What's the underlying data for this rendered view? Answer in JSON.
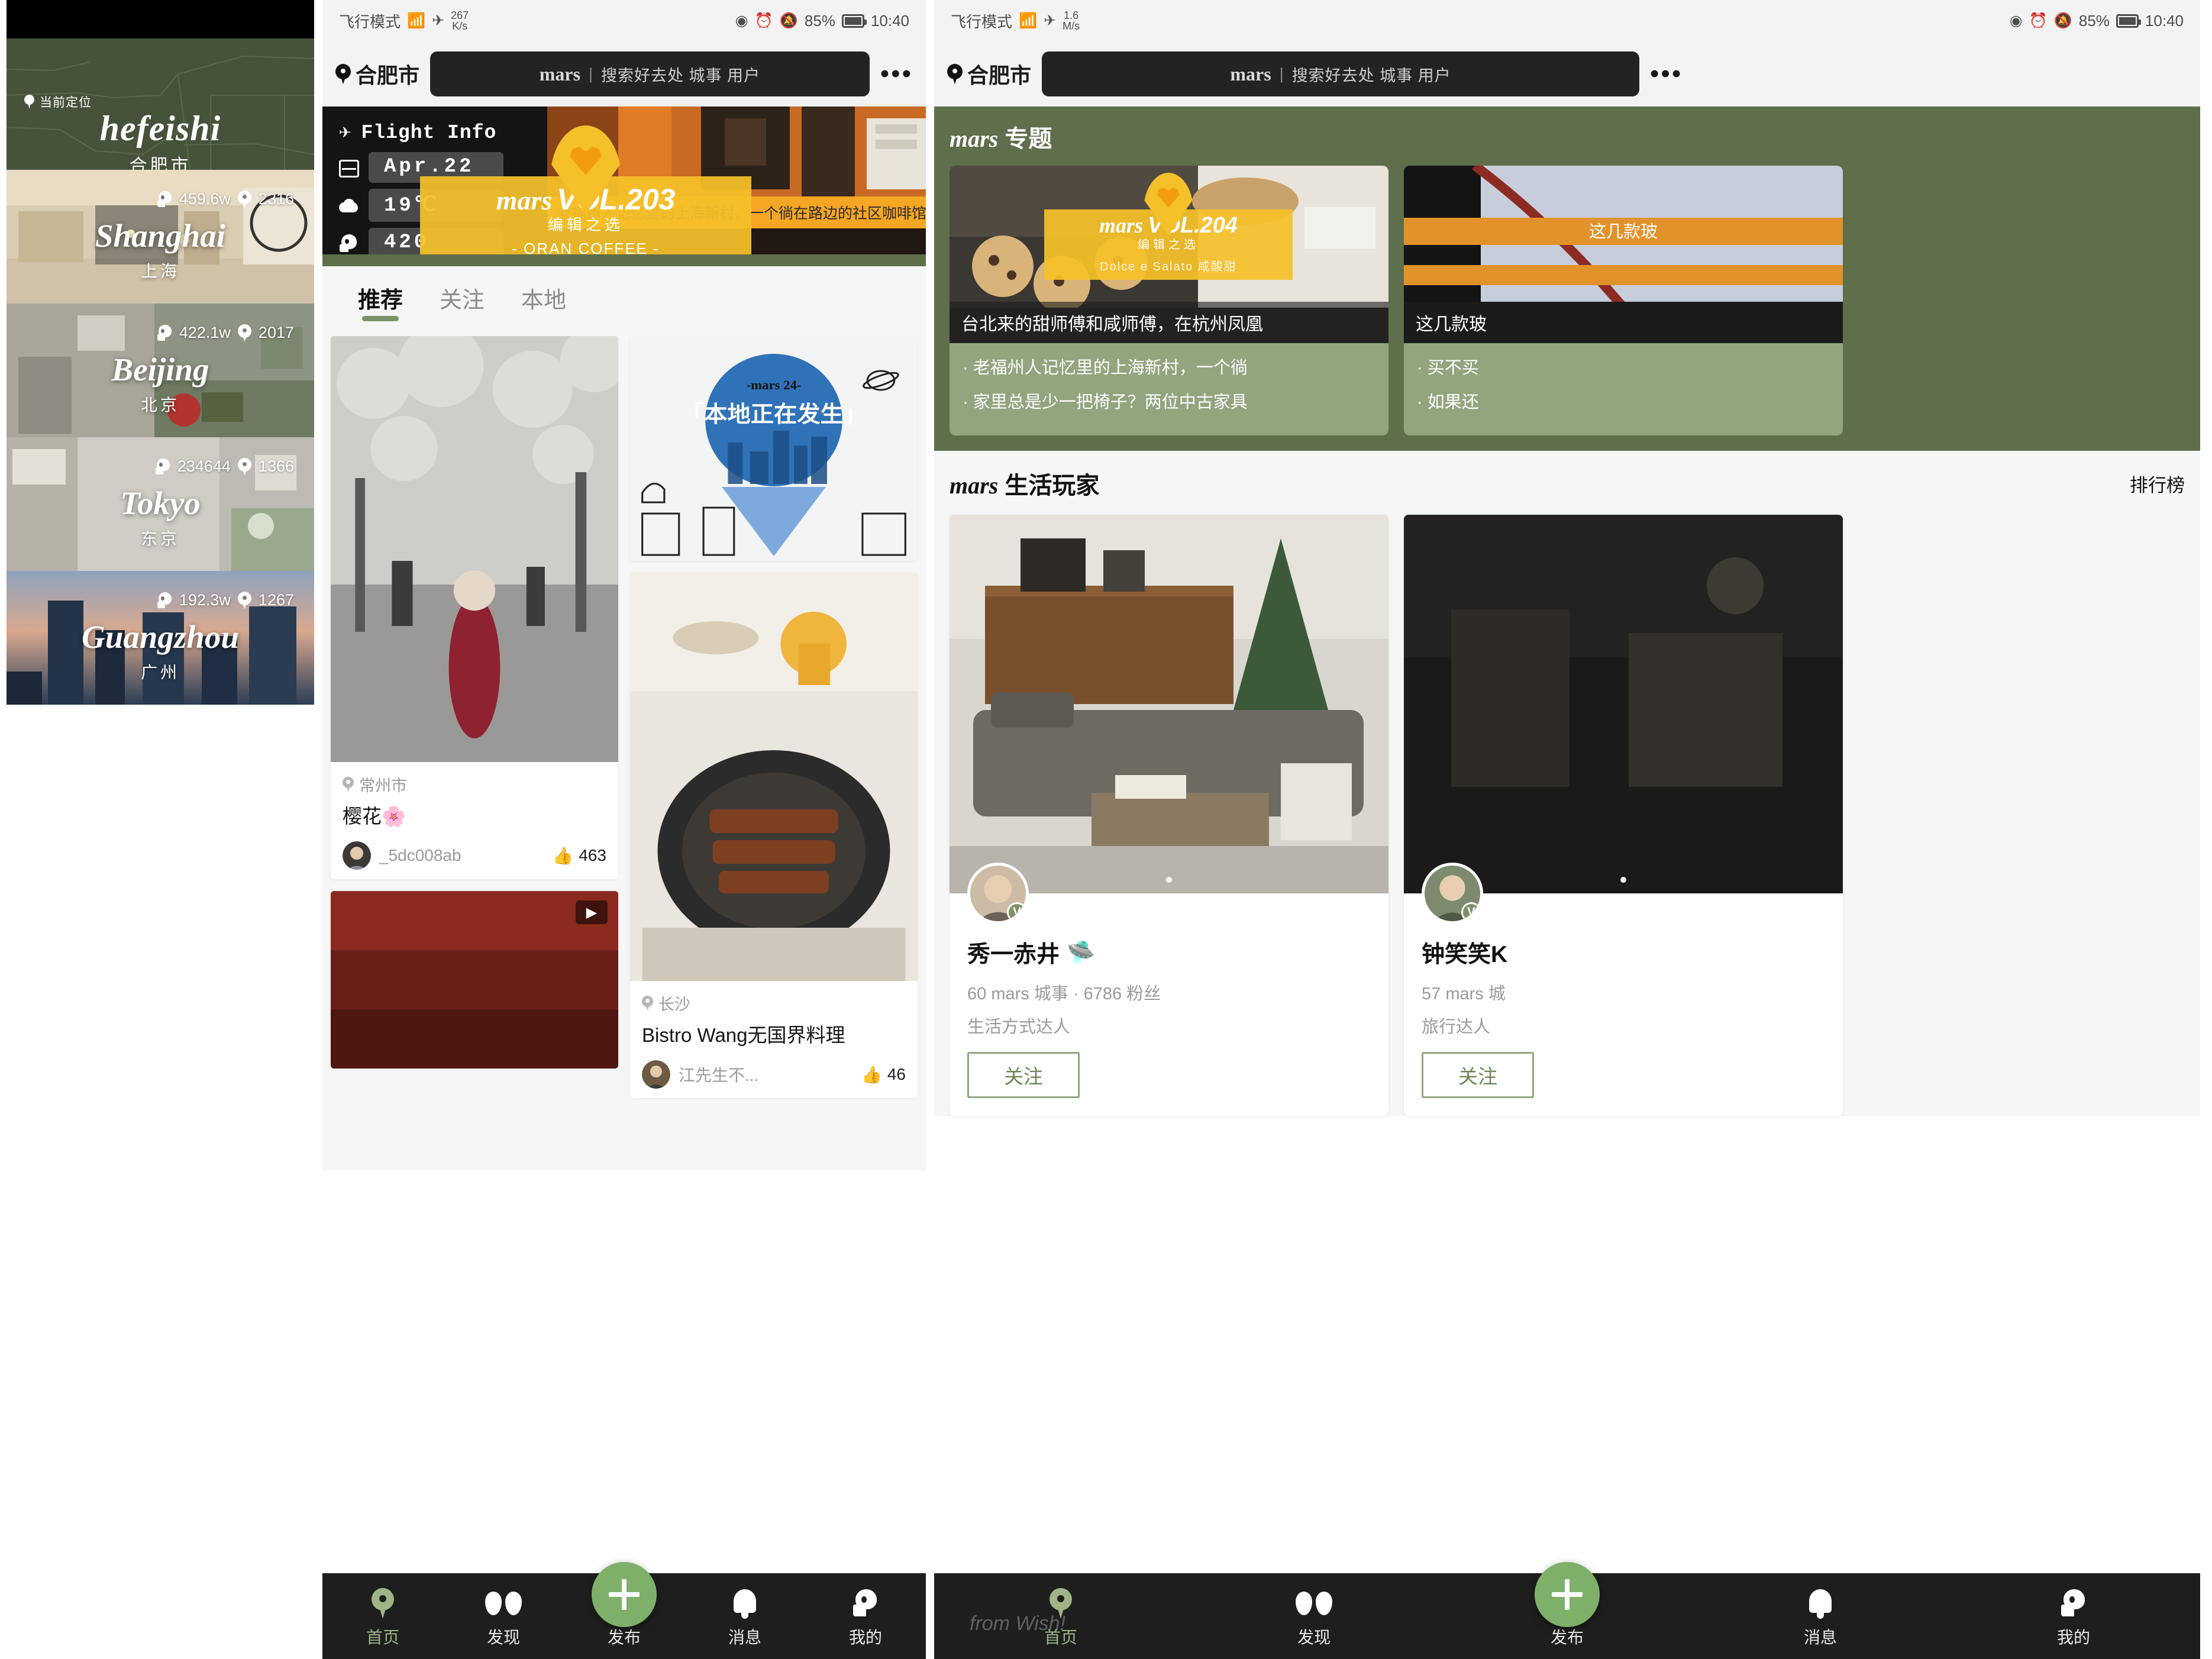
{
  "panel1": {
    "location_label": "当前定位",
    "hero_en": "hefeishi",
    "hero_cn": "合肥市",
    "cities": [
      {
        "en": "Shanghai",
        "cn": "上海",
        "people": "459.6w",
        "places": "2316"
      },
      {
        "en": "Beijing",
        "cn": "北京",
        "people": "422.1w",
        "places": "2017"
      },
      {
        "en": "Tokyo",
        "cn": "东京",
        "people": "234644",
        "places": "1366"
      },
      {
        "en": "Guangzhou",
        "cn": "广州",
        "people": "192.3w",
        "places": "1267"
      }
    ]
  },
  "statusbar2": {
    "mode": "飞行模式",
    "speed_value": "267",
    "speed_unit": "K/s",
    "battery": "85%",
    "time": "10:40"
  },
  "statusbar3": {
    "mode": "飞行模式",
    "speed_value": "1.6",
    "speed_unit": "M/s",
    "battery": "85%",
    "time": "10:40"
  },
  "header": {
    "city": "合肥市",
    "brand": "mars",
    "divider": "|",
    "placeholder": "搜索好去处 城事 用户",
    "more": "•••"
  },
  "flight": {
    "title": "Flight Info",
    "date": "Apr.22",
    "temp": "19℃",
    "count": "420"
  },
  "banner": {
    "brand": "mars",
    "sub": "编辑之选",
    "vol": "VOL.203",
    "store": "- ORAN COFFEE -",
    "caption": "老福州人记忆里的上海新村，一个徜在路边的社区咖啡馆"
  },
  "tabs": [
    {
      "label": "推荐",
      "active": true
    },
    {
      "label": "关注",
      "active": false
    },
    {
      "label": "本地",
      "active": false
    }
  ],
  "feed": {
    "left": [
      {
        "location": "常州市",
        "title": "樱花🌸",
        "user": "_5dc008ab",
        "likes": "463"
      }
    ],
    "right": [
      {
        "pin_brand": "-mars 24-",
        "pin_text": "「本地正在发生」"
      },
      {
        "location": "长沙",
        "title": "Bistro Wang无国界料理",
        "user": "江先生不...",
        "likes": "46"
      }
    ]
  },
  "topic": {
    "heading_brand": "mars",
    "heading_text": "专题",
    "cards": [
      {
        "brand": "mars",
        "sub": "编辑之选",
        "vol": "VOL.204",
        "store": "Dolce e Salato 咸酸甜",
        "caption": "台北来的甜师傅和咸师傅，在杭州凤凰",
        "items": [
          "· 老福州人记忆里的上海新村，一个徜",
          "· 家里总是少一把椅子？两位中古家具"
        ]
      },
      {
        "caption_top": "这几款玻",
        "caption": "这几款玻",
        "items": [
          "· 买不买",
          "· 如果还"
        ]
      }
    ]
  },
  "players": {
    "heading_brand": "mars",
    "heading_text": "生活玩家",
    "rank_link": "排行榜",
    "cards": [
      {
        "name": "秀一赤井",
        "emoji": "🛸",
        "badge": "V",
        "stats": "60 mars 城事 · 6786 粉丝",
        "tag": "生活方式达人",
        "follow": "关注"
      },
      {
        "name": "钟笑笑K",
        "emoji": "",
        "badge": "V",
        "stats": "57 mars 城",
        "tag": "旅行达人",
        "follow": "关注"
      }
    ]
  },
  "bottomnav": [
    {
      "label": "首页",
      "icon": "pin-icon",
      "active": true
    },
    {
      "label": "发现",
      "icon": "binocular-icon",
      "active": false
    },
    {
      "label": "发布",
      "icon": "plus-icon",
      "active": false
    },
    {
      "label": "消息",
      "icon": "bell-icon",
      "active": false
    },
    {
      "label": "我的",
      "icon": "profile-icon",
      "active": false
    }
  ],
  "watermark": "from Wish!",
  "colors": {
    "brand_green": "#5f6e4b",
    "accent_green": "#7fb069",
    "banner_yellow": "#f5c12a",
    "dark": "#1e1e1e"
  }
}
